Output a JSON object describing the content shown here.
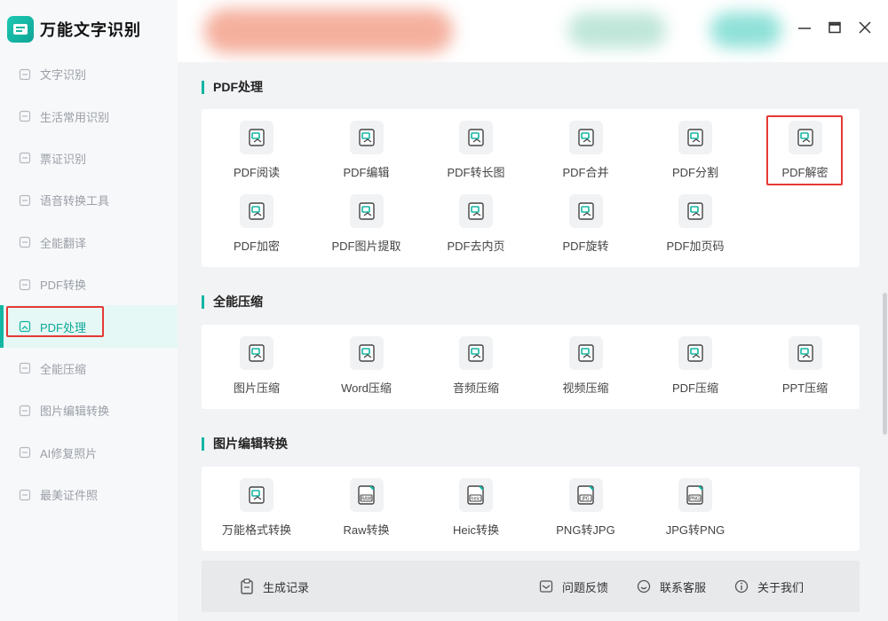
{
  "app": {
    "name": "万能文字识别"
  },
  "sidebar": {
    "items": [
      {
        "label": "文字识别",
        "icon": "scan-text-icon"
      },
      {
        "label": "生活常用识别",
        "icon": "scan-life-icon"
      },
      {
        "label": "票证识别",
        "icon": "scan-ticket-icon"
      },
      {
        "label": "语音转换工具",
        "icon": "voice-convert-icon"
      },
      {
        "label": "全能翻译",
        "icon": "translate-icon"
      },
      {
        "label": "PDF转换",
        "icon": "pdf-convert-icon"
      },
      {
        "label": "PDF处理",
        "icon": "pdf-process-icon",
        "active": true
      },
      {
        "label": "全能压缩",
        "icon": "compress-icon"
      },
      {
        "label": "图片编辑转换",
        "icon": "image-edit-icon"
      },
      {
        "label": "AI修复照片",
        "icon": "ai-repair-icon"
      },
      {
        "label": "最美证件照",
        "icon": "id-photo-icon"
      }
    ]
  },
  "sections": {
    "pdf": {
      "title": "PDF处理",
      "tools": [
        {
          "label": "PDF阅读",
          "icon": "pdf-read-icon"
        },
        {
          "label": "PDF编辑",
          "icon": "pdf-edit-icon"
        },
        {
          "label": "PDF转长图",
          "icon": "pdf-long-image-icon"
        },
        {
          "label": "PDF合并",
          "icon": "pdf-merge-icon"
        },
        {
          "label": "PDF分割",
          "icon": "pdf-split-icon"
        },
        {
          "label": "PDF解密",
          "icon": "pdf-decrypt-icon",
          "highlighted": true
        },
        {
          "label": "PDF加密",
          "icon": "pdf-encrypt-icon"
        },
        {
          "label": "PDF图片提取",
          "icon": "pdf-image-extract-icon"
        },
        {
          "label": "PDF去内页",
          "icon": "pdf-remove-pages-icon"
        },
        {
          "label": "PDF旋转",
          "icon": "pdf-rotate-icon"
        },
        {
          "label": "PDF加页码",
          "icon": "pdf-page-number-icon"
        }
      ]
    },
    "compress": {
      "title": "全能压缩",
      "tools": [
        {
          "label": "图片压缩",
          "icon": "image-compress-icon"
        },
        {
          "label": "Word压缩",
          "icon": "word-compress-icon"
        },
        {
          "label": "音频压缩",
          "icon": "audio-compress-icon"
        },
        {
          "label": "视频压缩",
          "icon": "video-compress-icon"
        },
        {
          "label": "PDF压缩",
          "icon": "pdf-compress-icon"
        },
        {
          "label": "PPT压缩",
          "icon": "ppt-compress-icon"
        }
      ]
    },
    "image": {
      "title": "图片编辑转换",
      "tools": [
        {
          "label": "万能格式转换",
          "icon": "format-convert-icon"
        },
        {
          "label": "Raw转换",
          "icon": "raw-convert-icon",
          "badge": "RAW"
        },
        {
          "label": "Heic转换",
          "icon": "heic-convert-icon",
          "badge": "heic"
        },
        {
          "label": "PNG转JPG",
          "icon": "png-to-jpg-icon",
          "badge": "JPG"
        },
        {
          "label": "JPG转PNG",
          "icon": "jpg-to-png-icon",
          "badge": "PNG"
        }
      ]
    }
  },
  "footer": {
    "history": "生成记录",
    "feedback": "问题反馈",
    "support": "联系客服",
    "about": "关于我们"
  },
  "colors": {
    "accent": "#13b5a3",
    "highlight": "#e53935"
  }
}
